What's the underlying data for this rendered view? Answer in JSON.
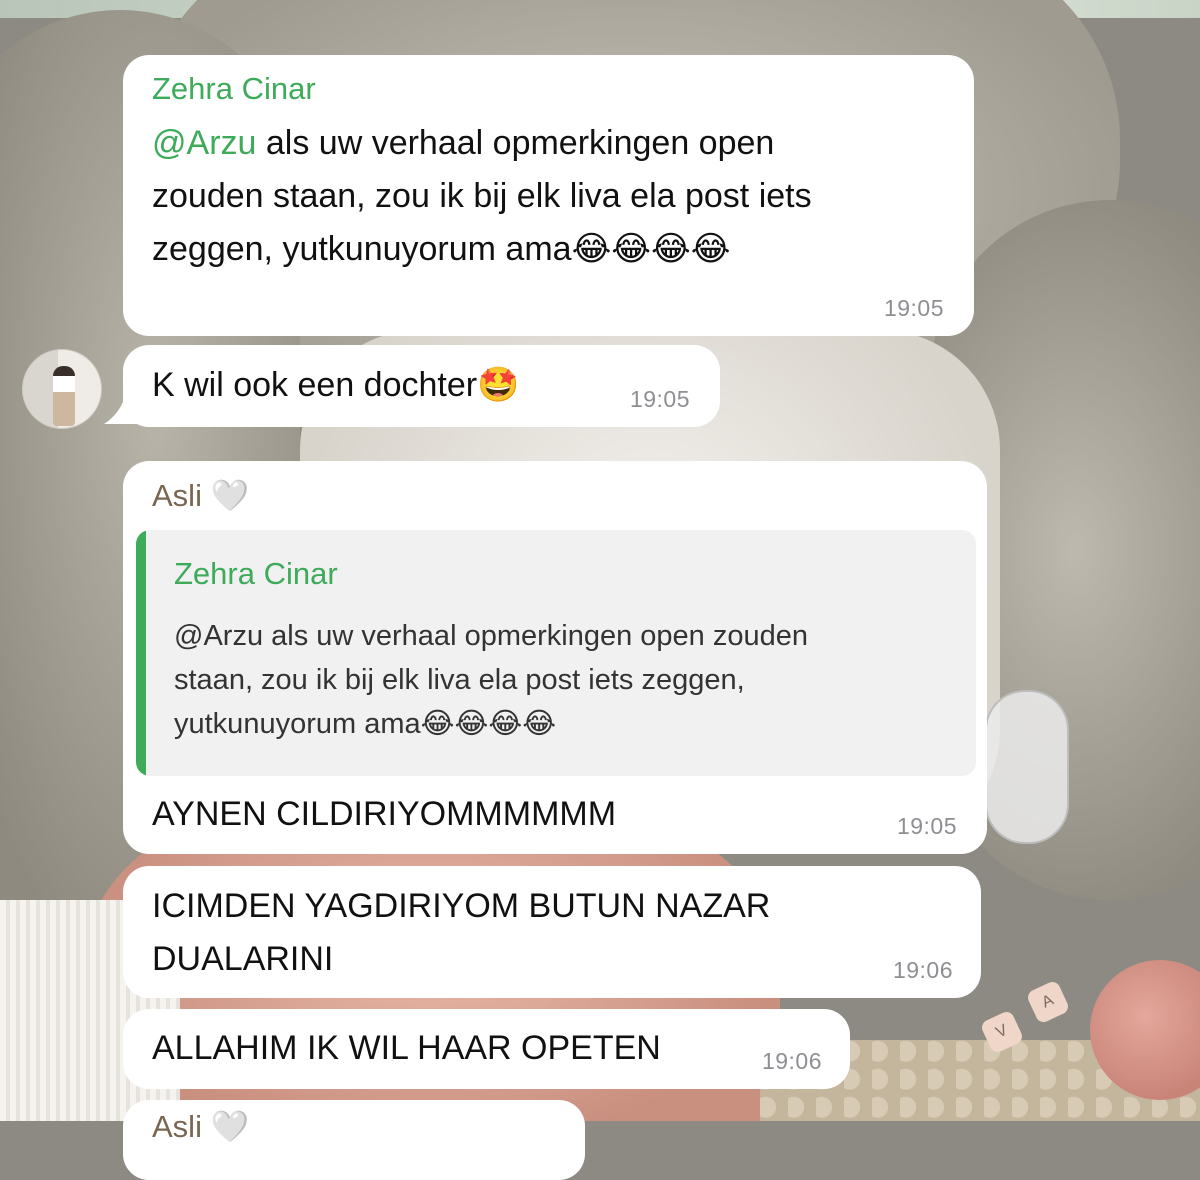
{
  "messages": [
    {
      "sender": "Zehra Cinar",
      "sender_color": "#3dab5a",
      "mention": "@Arzu",
      "text_lines": [
        " als uw verhaal opmerkingen open",
        "zouden staan, zou ik bij elk liva ela post iets",
        "zeggen, yutkunuyorum ama😂😂😂😂"
      ],
      "time": "19:05"
    },
    {
      "text": "K wil ook een dochter🤩",
      "time": "19:05",
      "avatar_icon": "profile-photo"
    },
    {
      "sender": "Asli 🤍",
      "sender_color": "#7a6551",
      "quote": {
        "sender": "Zehra Cinar",
        "mention": "@Arzu",
        "text_lines": [
          " als uw verhaal opmerkingen open zouden",
          "staan, zou ik bij elk liva ela post iets zeggen,",
          "yutkunuyorum ama😂😂😂😂"
        ]
      },
      "text": "AYNEN CILDIRIYOMMMMMM",
      "time": "19:05"
    },
    {
      "text_lines": [
        "ICIMDEN YAGDIRIYOM BUTUN NAZAR",
        "DUALARINI"
      ],
      "time": "19:06"
    },
    {
      "text": "ALLAHIM IK WIL HAAR OPETEN",
      "time": "19:06"
    },
    {
      "sender": "Asli 🤍"
    }
  ],
  "accent_color": "#3dab5a",
  "background": {
    "bead_letters": [
      "V",
      "A"
    ]
  }
}
